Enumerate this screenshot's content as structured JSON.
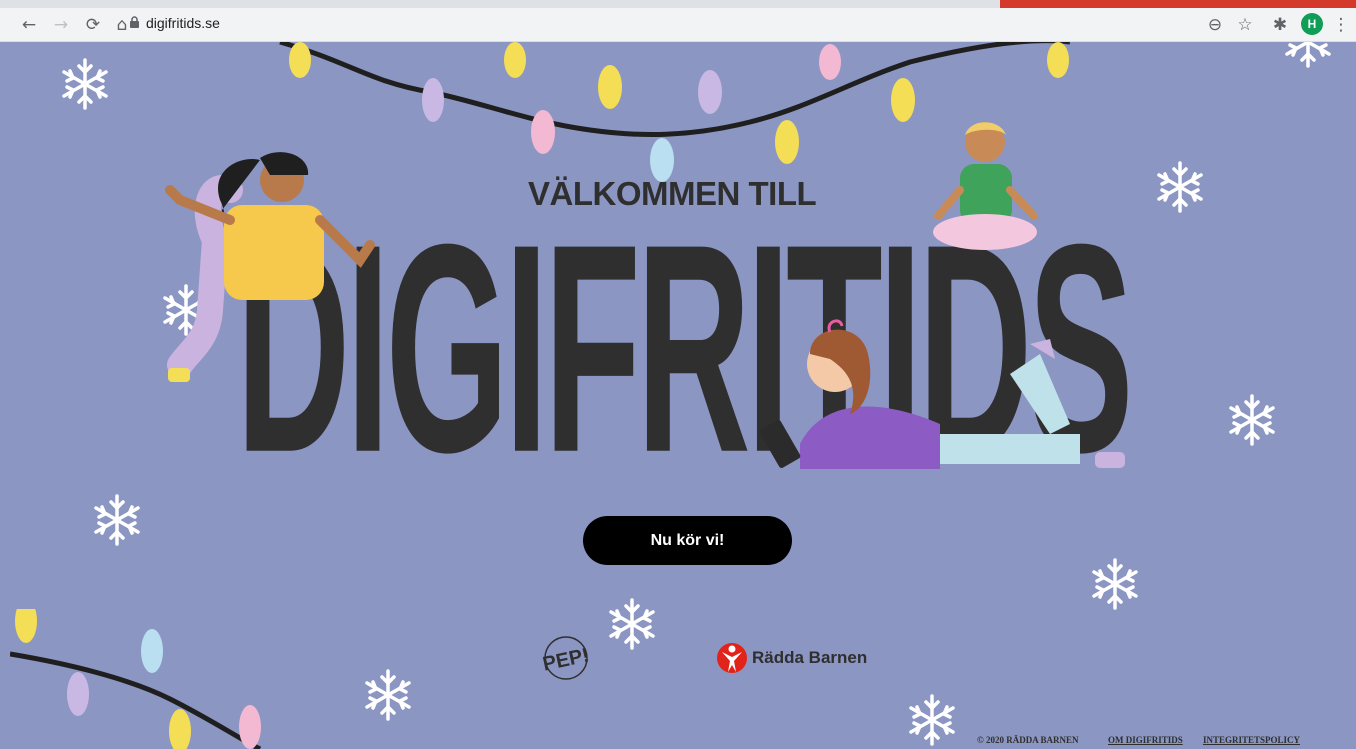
{
  "browser": {
    "url": "digifritids.se",
    "profile_initial": "H",
    "nav_icons": [
      "back-arrow-icon",
      "forward-arrow-icon",
      "reload-icon",
      "home-icon"
    ],
    "toolbar_icons": [
      "zoom-icon",
      "star-icon",
      "extensions-icon",
      "menu-dots-icon"
    ]
  },
  "hero": {
    "welcome": "VÄLKOMMEN TILL",
    "title": "DIGIFRITIDS",
    "cta": "Nu kör vi!"
  },
  "partners": {
    "pep_logo": "PEP!",
    "radda_barnen": "Rädda Barnen"
  },
  "footer": {
    "copyright": "© 2020 RÄDDA BARNEN",
    "about": "OM DIGIFRITIDS",
    "privacy": "INTEGRITETSPOLICY"
  },
  "colors": {
    "background": "#8b96c3",
    "text_dark": "#2f2f2f",
    "button": "#000000",
    "radda_red": "#e2231a"
  }
}
